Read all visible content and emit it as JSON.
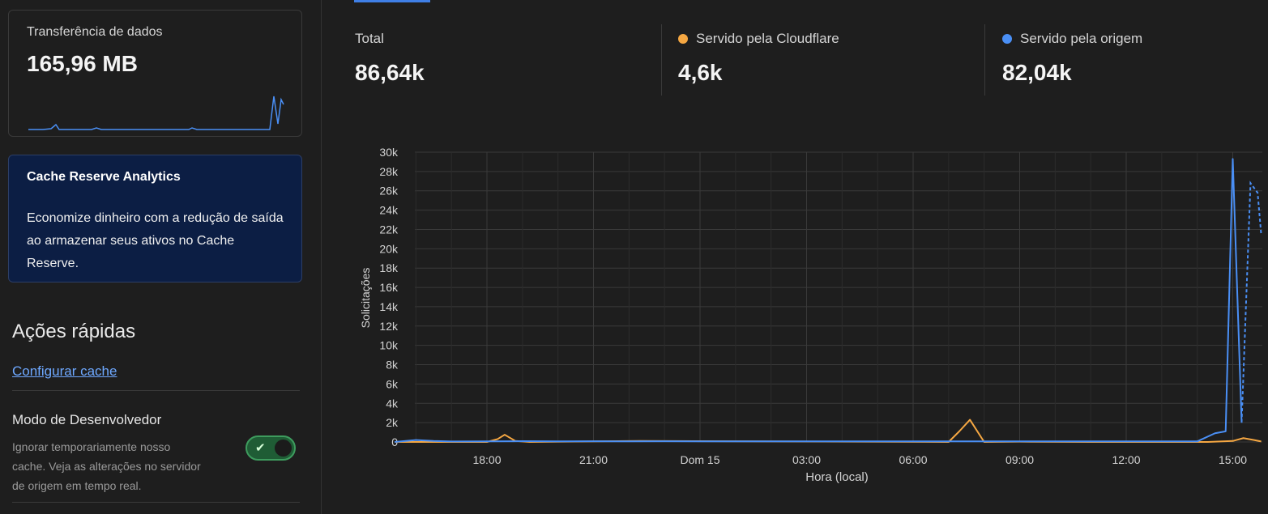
{
  "sidebar": {
    "transfer": {
      "label": "Transferência de dados",
      "value": "165,96 MB"
    },
    "cache_reserve": {
      "title": "Cache Reserve Analytics",
      "description": "Economize dinheiro com a redução de saída ao armazenar seus ativos no Cache Reserve."
    },
    "quick_actions": {
      "title": "Ações rápidas",
      "configure_cache_link": "Configurar cache",
      "dev_mode": {
        "title": "Modo de Desenvolvedor",
        "description": "Ignorar temporariamente nosso cache. Veja as alterações no servidor de origem em tempo real.",
        "enabled": true
      }
    }
  },
  "stats": [
    {
      "label": "Total",
      "value": "86,64k",
      "dot_color": ""
    },
    {
      "label": "Servido pela Cloudflare",
      "value": "4,6k",
      "dot_color": "#f5a742"
    },
    {
      "label": "Servido pela origem",
      "value": "82,04k",
      "dot_color": "#4a8ff5"
    }
  ],
  "colors": {
    "accent": "#3f7fe6",
    "cloudflare": "#f5a742",
    "origin": "#4a8ff5",
    "toggle_on": "#1f5c35"
  },
  "chart_data": {
    "type": "line",
    "xlabel": "Hora (local)",
    "ylabel": "Solicitações",
    "ylim": [
      0,
      30000
    ],
    "y_ticks": [
      "30k",
      "28k",
      "26k",
      "24k",
      "22k",
      "20k",
      "18k",
      "16k",
      "14k",
      "12k",
      "10k",
      "8k",
      "6k",
      "4k",
      "2k",
      "0"
    ],
    "x_ticks": [
      "18:00",
      "21:00",
      "Dom 15",
      "03:00",
      "06:00",
      "09:00",
      "12:00",
      "15:00"
    ],
    "grid": true,
    "series": [
      {
        "name": "Servido pela origem",
        "color": "#4a8ff5",
        "x": [
          -2.6,
          -2.0,
          -1.5,
          -1.0,
          0,
          1,
          2,
          3,
          4,
          5,
          6,
          7,
          8,
          9,
          10,
          11,
          12,
          13,
          14,
          15,
          16,
          17,
          18,
          19,
          20,
          20.5,
          20.8,
          21.0,
          21.25,
          21.5,
          21.7,
          21.8
        ],
        "values": [
          0,
          200,
          100,
          50,
          60,
          80,
          60,
          70,
          60,
          70,
          60,
          60,
          60,
          60,
          60,
          60,
          60,
          60,
          60,
          60,
          60,
          60,
          60,
          60,
          60,
          900,
          1100,
          29300,
          2000,
          26800,
          25800,
          21500
        ],
        "dashed_from_index": 29
      },
      {
        "name": "Servido pela Cloudflare",
        "color": "#f5a742",
        "x": [
          -2.6,
          -1.0,
          0,
          0.3,
          0.5,
          0.8,
          1.2,
          4.3,
          13.0,
          13.3,
          13.6,
          14.0,
          15.0,
          17.0,
          20.3,
          21.0,
          21.3,
          21.6,
          21.8
        ],
        "values": [
          0,
          0,
          0,
          300,
          750,
          100,
          0,
          100,
          0,
          1100,
          2300,
          0,
          30,
          0,
          0,
          100,
          400,
          200,
          50
        ]
      }
    ]
  }
}
